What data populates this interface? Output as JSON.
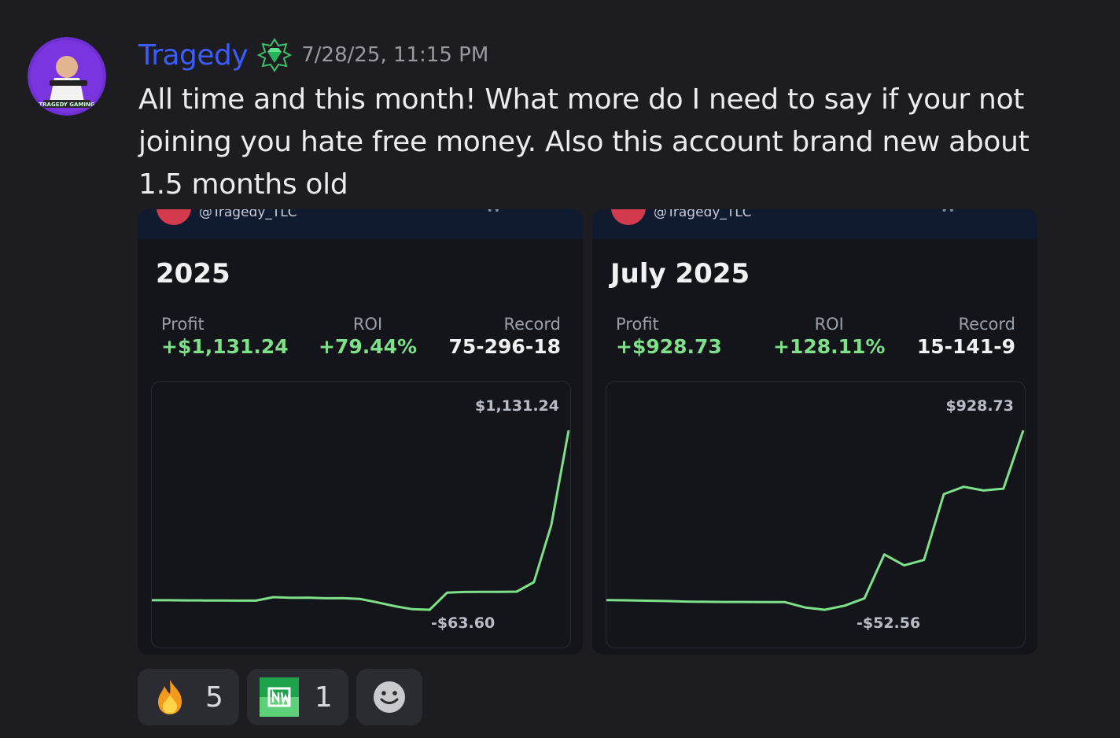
{
  "message": {
    "author": "Tragedy",
    "timestamp": "7/28/25, 11:15 PM",
    "text": "All time and this month! What more do I need to say if your not joining you hate free money. Also this account brand new about 1.5 months old",
    "avatar_text": "TRAGEDY GAMING",
    "badge_icon": "emerald-badge-icon"
  },
  "cards": [
    {
      "handle": "@Tragedy_TLC",
      "title": "2025",
      "profit_label": "Profit",
      "profit": "+$1,131.24",
      "roi_label": "ROI",
      "roi": "+79.44%",
      "record_label": "Record",
      "record": "75-296-18",
      "max_label": "$1,131.24",
      "min_label": "-$63.60"
    },
    {
      "handle": "@Tragedy_TLC",
      "title": "July 2025",
      "profit_label": "Profit",
      "profit": "+$928.73",
      "roi_label": "ROI",
      "roi": "+128.11%",
      "record_label": "Record",
      "record": "15-141-9",
      "max_label": "$928.73",
      "min_label": "-$52.56"
    }
  ],
  "chart_data": [
    {
      "type": "line",
      "title": "2025",
      "max": 1131.24,
      "min": -63.6,
      "series": [
        {
          "values": [
            0,
            0,
            -1,
            -2,
            -2,
            -3,
            -3,
            20,
            16,
            17,
            13,
            14,
            8,
            -15,
            -40,
            -60,
            -63.6,
            50,
            55,
            56,
            56,
            57,
            120,
            500,
            1131.24
          ]
        }
      ],
      "color": "#7fe08a"
    },
    {
      "type": "line",
      "title": "July 2025",
      "max": 928.73,
      "min": -52.56,
      "series": [
        {
          "values": [
            0,
            -1,
            -3,
            -5,
            -8,
            -9,
            -10,
            -10,
            -11,
            -11,
            -40,
            -52.56,
            -30,
            10,
            250,
            190,
            220,
            580,
            620,
            600,
            610,
            928.73
          ]
        }
      ],
      "color": "#7fe08a"
    }
  ],
  "reactions": [
    {
      "emoji": "fire-emoji",
      "count": "5"
    },
    {
      "emoji": "custom-green-emoji",
      "count": "1"
    }
  ]
}
